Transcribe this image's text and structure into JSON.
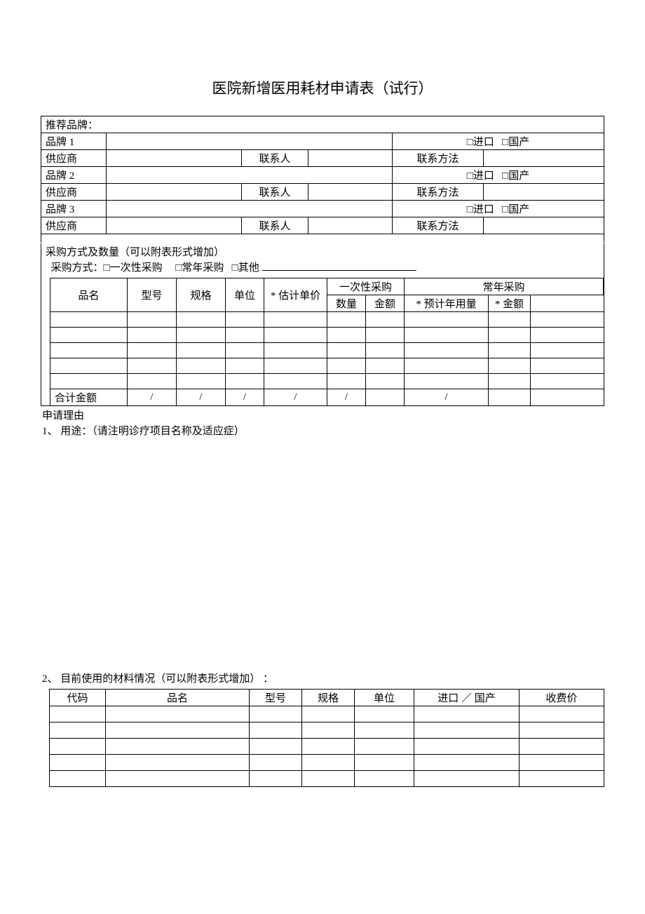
{
  "title": "医院新增医用耗材申请表（试行）",
  "rec": {
    "header": "推荐品牌：",
    "brand1": "品牌 1",
    "brand2": "品牌 2",
    "brand3": "品牌 3",
    "supplier": "供应商",
    "contact": "联系人",
    "contactMethod": "联系方法",
    "import": "进口",
    "domestic": "国产"
  },
  "purchase": {
    "header": "采购方式及数量（可以附表形式增加）",
    "modeLabel": "采购方式：",
    "oneTime": "一次性采购",
    "annual": "常年采购",
    "other": "其他",
    "cols": {
      "name": "品名",
      "model": "型号",
      "spec": "规格",
      "unit": "单位",
      "estPrice": "* 估计单价",
      "oneTimeBuy": "一次性采购",
      "annualBuy": "常年采购",
      "qty": "数量",
      "amt": "金额",
      "estAnnual": "* 预计年用量",
      "amt2": "* 金额"
    },
    "totalLabel": "合计金额",
    "slash": "/"
  },
  "reason": {
    "header": "申请理由",
    "line1": "1、 用途：（请注明诊疗项目名称及适应症）",
    "line2": "2、 目前使用的材料情况（可以附表形式增加） ："
  },
  "materials": {
    "cols": {
      "code": "代码",
      "name": "品名",
      "model": "型号",
      "spec": "规格",
      "unit": "单位",
      "origin": "进口 ／ 国产",
      "price": "收费价"
    }
  }
}
